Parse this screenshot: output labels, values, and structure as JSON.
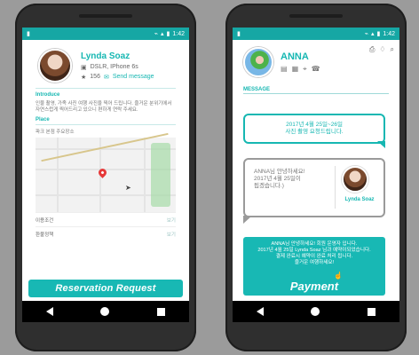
{
  "left": {
    "status_time": "1:42",
    "profile": {
      "name": "Lynda Soaz",
      "equipment_icon": "camera-icon",
      "equipment": "DSLR, IPhone 6s",
      "rating_icon": "star-icon",
      "rating": "156",
      "message_icon": "message-icon",
      "send_message": "Send message"
    },
    "introduce": {
      "label": "Introduce",
      "text": "인물 촬영, 가족 사진 여행 사진을 찍어 드립니다. 즐거운 분위기에서 자연스럽게 찍어드리고 있으니 편하게 연락 주세요."
    },
    "place": {
      "label": "Place",
      "text": "파크 본점 주요장소"
    },
    "info_rows": [
      {
        "label": "이용조건",
        "value": "보기"
      },
      {
        "label": "환불정책",
        "value": "보기"
      }
    ],
    "button": "Reservation Request"
  },
  "right": {
    "status_time": "1:42",
    "profile": {
      "name": "ANNA",
      "icons": [
        "wallet-icon",
        "calendar-icon",
        "location-icon",
        "phone-icon"
      ]
    },
    "top_icons": [
      "printer-icon",
      "bell-icon",
      "search-icon"
    ],
    "message_label": "MESSAGE",
    "bubble_top": {
      "line1": "2017년 4월 25일~26일",
      "line2": "사진 촬영 요청드립니다."
    },
    "bubble_second": {
      "line1": "ANNA님 안녕하세요!",
      "line2": "2017년 4월 25일이",
      "line3": "됩겠습니다.)",
      "sender": "Lynda Soaz"
    },
    "payment": {
      "line1": "ANNA님 안녕하세요! 회원 운영자 입니다.",
      "line2": "2017년 4월 25일 Lynda Soaz 님과 예약이되었습니다.",
      "line3": "결제 완료시 예약이 완료 처리 됩니다.",
      "line4": "즐거운 여행하세요!",
      "button": "Payment"
    }
  },
  "colors": {
    "accent": "#16b7b2",
    "status_bar": "#16a7a4",
    "background": "#9b9b9b"
  }
}
